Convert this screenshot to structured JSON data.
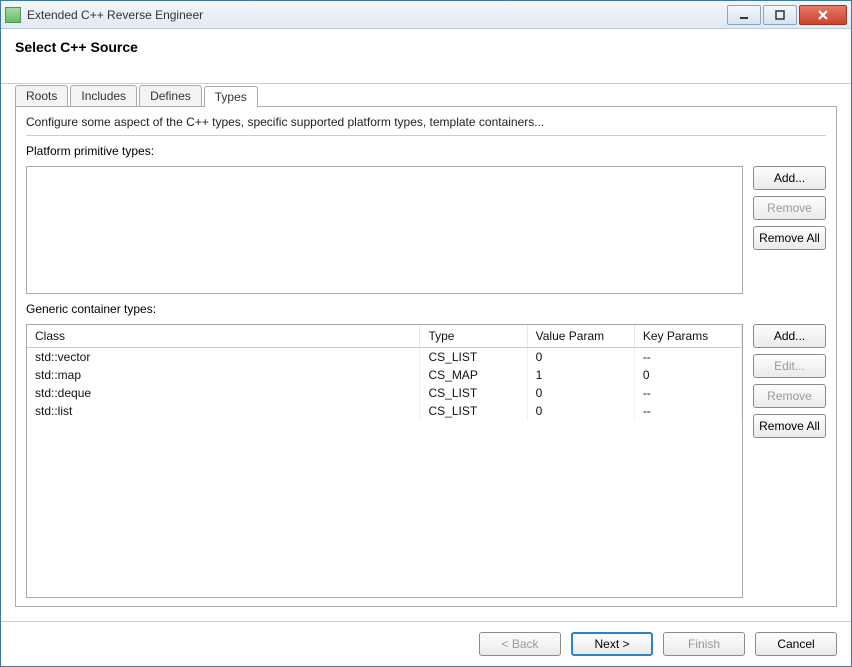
{
  "window": {
    "title": "Extended C++ Reverse Engineer"
  },
  "header": {
    "title": "Select C++ Source"
  },
  "tabs": {
    "roots": "Roots",
    "includes": "Includes",
    "defines": "Defines",
    "types": "Types",
    "active": "types"
  },
  "panel": {
    "config_text": "Configure some aspect of the C++ types, specific supported platform types, template containers...",
    "platform_label": "Platform primitive types:",
    "generic_label": "Generic container types:"
  },
  "buttons": {
    "add": "Add...",
    "remove": "Remove",
    "remove_all": "Remove All",
    "edit": "Edit...",
    "back": "< Back",
    "next": "Next >",
    "finish": "Finish",
    "cancel": "Cancel"
  },
  "table": {
    "headers": {
      "class": "Class",
      "type": "Type",
      "value_param": "Value Param",
      "key_params": "Key Params"
    },
    "rows": [
      {
        "class": "std::vector",
        "type": "CS_LIST",
        "value_param": "0",
        "key_params": "--"
      },
      {
        "class": "std::map",
        "type": "CS_MAP",
        "value_param": "1",
        "key_params": "0"
      },
      {
        "class": "std::deque",
        "type": "CS_LIST",
        "value_param": "0",
        "key_params": "--"
      },
      {
        "class": "std::list",
        "type": "CS_LIST",
        "value_param": "0",
        "key_params": "--"
      }
    ]
  }
}
